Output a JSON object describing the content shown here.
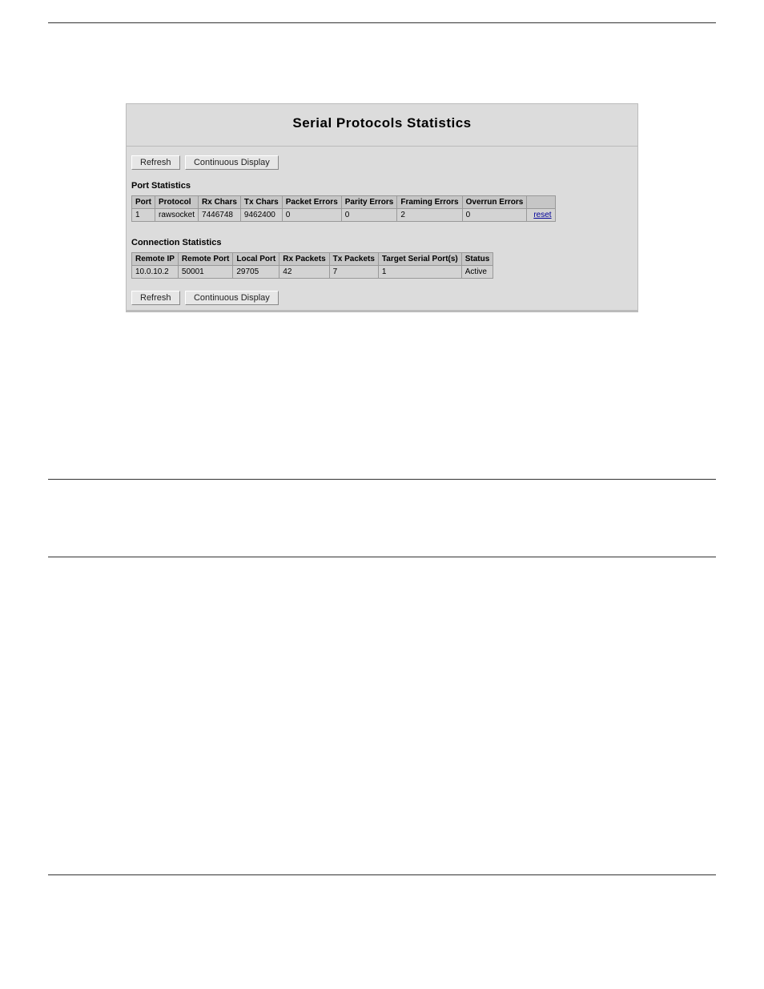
{
  "panel": {
    "title": "Serial Protocols Statistics",
    "buttons": {
      "refresh": "Refresh",
      "continuous": "Continuous Display"
    },
    "port_stats": {
      "heading": "Port Statistics",
      "headers": {
        "port": "Port",
        "protocol": "Protocol",
        "rx_chars": "Rx Chars",
        "tx_chars": "Tx Chars",
        "packet_errors": "Packet Errors",
        "parity_errors": "Parity Errors",
        "framing_errors": "Framing Errors",
        "overrun_errors": "Overrun Errors"
      },
      "rows": [
        {
          "port": "1",
          "protocol": "rawsocket",
          "rx_chars": "7446748",
          "tx_chars": "9462400",
          "packet_errors": "0",
          "parity_errors": "0",
          "framing_errors": "2",
          "overrun_errors": "0"
        }
      ],
      "reset_label": "reset"
    },
    "conn_stats": {
      "heading": "Connection Statistics",
      "headers": {
        "remote_ip": "Remote IP",
        "remote_port": "Remote Port",
        "local_port": "Local Port",
        "rx_packets": "Rx Packets",
        "tx_packets": "Tx Packets",
        "target_serial": "Target Serial Port(s)",
        "status": "Status"
      },
      "rows": [
        {
          "remote_ip": "10.0.10.2",
          "remote_port": "50001",
          "local_port": "29705",
          "rx_packets": "42",
          "tx_packets": "7",
          "target_serial": "1",
          "status": "Active"
        }
      ]
    }
  }
}
